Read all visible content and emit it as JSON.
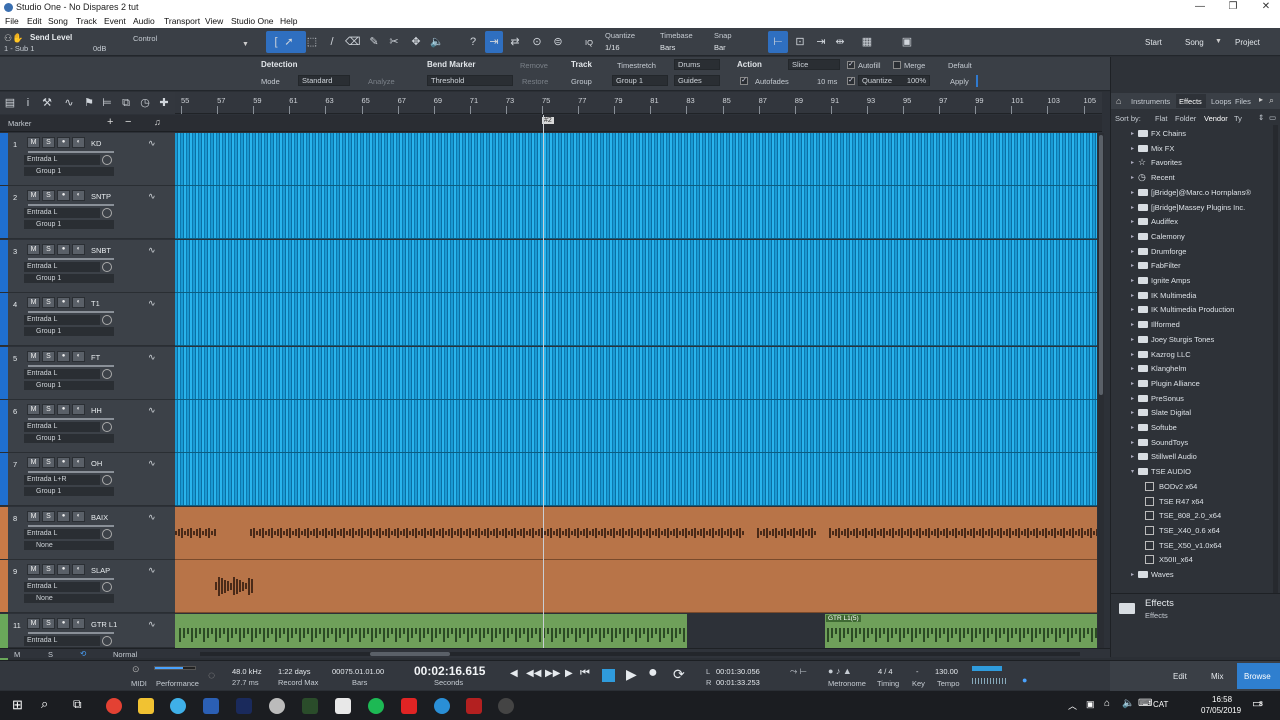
{
  "window": {
    "title": "Studio One - No Dispares 2 tut"
  },
  "menu": [
    "File",
    "Edit",
    "Song",
    "Track",
    "Event",
    "Audio",
    "Transport",
    "View",
    "Studio One",
    "Help"
  ],
  "toolbar": {
    "send_level": "Send Level",
    "send_sub": "1 - Sub 1",
    "send_value": "0dB",
    "control": "Control",
    "quantize_label": "Quantize",
    "quantize_value": "1/16",
    "timebase_label": "Timebase",
    "timebase_value": "Bars",
    "snap_label": "Snap",
    "snap_value": "Bar",
    "iq": "IQ",
    "start": "Start",
    "song": "Song",
    "project": "Project"
  },
  "inspector": {
    "detection": "Detection",
    "mode_label": "Mode",
    "mode_value": "Standard",
    "analyze": "Analyze",
    "bend_marker": "Bend Marker",
    "remove": "Remove",
    "threshold": "Threshold",
    "restore": "Restore",
    "track": "Track",
    "timestretch": "Timestretch",
    "drums": "Drums",
    "group_label": "Group",
    "group_value": "Group 1",
    "guides": "Guides",
    "action": "Action",
    "slice": "Slice",
    "autofill": "Autofill",
    "merge": "Merge",
    "default": "Default",
    "autofades": "Autofades",
    "autofades_ms": "10 ms",
    "quantize": "Quantize",
    "quantize_pct": "100%",
    "apply": "Apply"
  },
  "ruler": {
    "bars": [
      "55",
      "57",
      "59",
      "61",
      "63",
      "65",
      "67",
      "69",
      "71",
      "73",
      "75",
      "77",
      "79",
      "81",
      "83",
      "85",
      "87",
      "89",
      "91",
      "93",
      "95",
      "97",
      "99",
      "101",
      "103",
      "105"
    ]
  },
  "marker": {
    "label": "Marker",
    "flag": "#2"
  },
  "tracks": [
    {
      "num": "1",
      "name": "KD",
      "input": "Entrada L",
      "group": "Group 1",
      "color": "#1f6fd0"
    },
    {
      "num": "2",
      "name": "SNTP",
      "input": "Entrada L",
      "group": "Group 1",
      "color": "#1f6fd0"
    },
    {
      "num": "3",
      "name": "SNBT",
      "input": "Entrada L",
      "group": "Group 1",
      "color": "#1f6fd0"
    },
    {
      "num": "4",
      "name": "T1",
      "input": "Entrada L",
      "group": "Group 1",
      "color": "#1f6fd0"
    },
    {
      "num": "5",
      "name": "FT",
      "input": "Entrada L",
      "group": "Group 1",
      "color": "#1f6fd0"
    },
    {
      "num": "6",
      "name": "HH",
      "input": "Entrada L",
      "group": "Group 1",
      "color": "#1f6fd0"
    },
    {
      "num": "7",
      "name": "OH",
      "input": "Entrada L+R",
      "group": "Group 1",
      "color": "#1f6fd0"
    },
    {
      "num": "8",
      "name": "BAIX",
      "input": "Entrada L",
      "group": "None",
      "color": "#c97a47"
    },
    {
      "num": "9",
      "name": "SLAP",
      "input": "Entrada L",
      "group": "None",
      "color": "#c97a47"
    },
    {
      "num": "11",
      "name": "GTR L1",
      "input": "Entrada L",
      "group": "None",
      "color": "#6aa85a"
    }
  ],
  "track_buttons": {
    "m": "M",
    "s": "S"
  },
  "lanes": {
    "guitar_clip": "GTR L1(5)"
  },
  "footer_left": {
    "m": "M",
    "s": "S",
    "mode": "Normal"
  },
  "browser": {
    "tabs": [
      "Instruments",
      "Effects",
      "Loops",
      "Files"
    ],
    "active_tab": "Effects",
    "sort_label": "Sort by:",
    "sort_options": [
      "Flat",
      "Folder",
      "Vendor",
      "Ty"
    ],
    "items": [
      "FX Chains",
      "Mix FX",
      "Favorites",
      "Recent",
      "[jBridge]@Marc.o Hornplans®",
      "[jBridge]Massey Plugins Inc.",
      "Audiffex",
      "Calemony",
      "Drumforge",
      "FabFilter",
      "Ignite Amps",
      "IK Multimedia",
      "IK Multimedia Production",
      "Illformed",
      "Joey Sturgis Tones",
      "Kazrog LLC",
      "Klanghelm",
      "Plugin Alliance",
      "PreSonus",
      "Slate Digital",
      "Softube",
      "SoundToys",
      "Stillwell Audio",
      "TSE AUDIO"
    ],
    "tse_plugins": [
      "BODv2 x64",
      "TSE R47 x64",
      "TSE_808_2.0_x64",
      "TSE_X40_0.6 x64",
      "TSE_X50_v1.0x64",
      "X50II_x64"
    ],
    "last_item": "Waves",
    "footer_title": "Effects",
    "footer_sub": "Effects"
  },
  "transport": {
    "midi": "MIDI",
    "performance": "Performance",
    "sample_rate": "48.0 kHz",
    "latency": "27.7 ms",
    "record_days": "1:22 days",
    "record_max": "Record Max",
    "bars_value": "00075.01.01.00",
    "bars_label": "Bars",
    "time_value": "00:02:16.615",
    "seconds_label": "Seconds",
    "loop_l": "00:01:30.056",
    "loop_r": "00:01:33.253",
    "l_label": "L",
    "r_label": "R",
    "metronome": "Metronome",
    "timing_value": "4 / 4",
    "timing_label": "Timing",
    "key_value": "-",
    "key_label": "Key",
    "tempo_value": "130.00",
    "tempo_label": "Tempo",
    "edit": "Edit",
    "mix": "Mix",
    "browse": "Browse"
  },
  "taskbar": {
    "lang": "CAT",
    "time": "16:58",
    "date": "07/05/2019",
    "notif": "8"
  }
}
